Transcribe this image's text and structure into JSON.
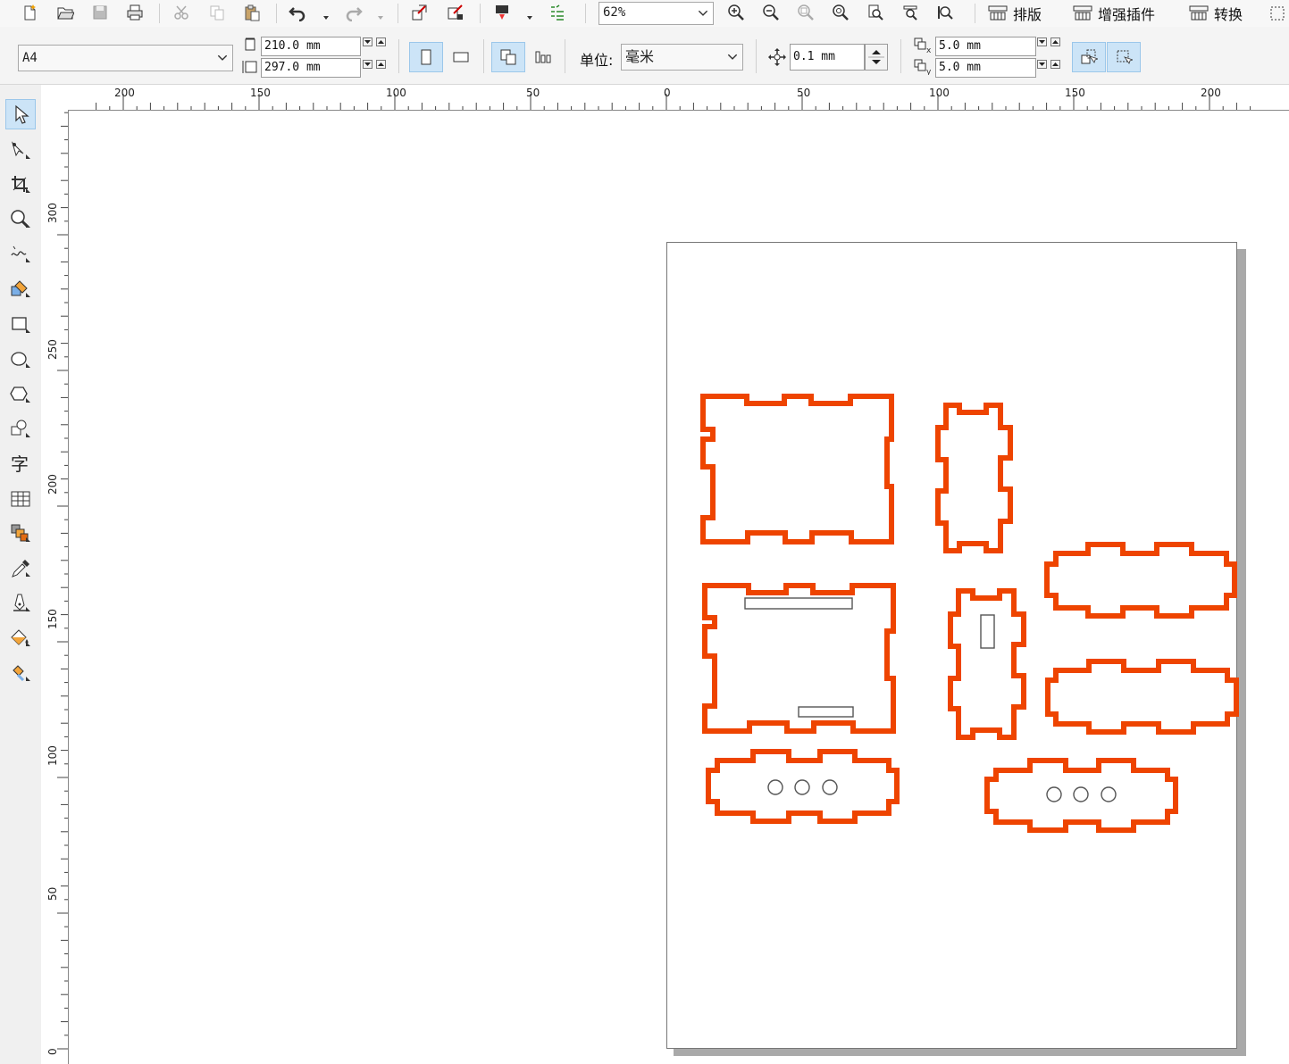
{
  "toolbar": {
    "zoom_value": "62%",
    "plugins": [
      {
        "label": "排版"
      },
      {
        "label": "增强插件"
      },
      {
        "label": "转换"
      }
    ]
  },
  "property_bar": {
    "page_size": "A4",
    "width": "210.0 mm",
    "height": "297.0 mm",
    "unit_label": "单位:",
    "unit_value": "毫米",
    "nudge": "0.1 mm",
    "dup_x": "5.0 mm",
    "dup_y": "5.0 mm"
  },
  "ruler_h": {
    "labels": [
      "200",
      "150",
      "100",
      "50",
      "0",
      "50",
      "100",
      "150",
      "200"
    ]
  },
  "ruler_v": {
    "labels": [
      "300",
      "250",
      "200",
      "150",
      "100",
      "50",
      "0"
    ]
  },
  "colors": {
    "cut_line": "#ee4400",
    "engrave_line": "#555555",
    "page_border": "#777777",
    "selected_button": "#cce4f7"
  },
  "icons": {
    "toolbar": [
      "new-document-icon",
      "open-icon",
      "save-icon",
      "print-icon",
      "cut-icon",
      "copy-icon",
      "paste-icon",
      "undo-icon",
      "redo-icon",
      "import-icon",
      "export-icon",
      "publish-icon",
      "launcher-icon",
      "zoom-in-icon",
      "zoom-out-icon",
      "zoom-selected-icon",
      "zoom-all-icon",
      "zoom-page-icon",
      "zoom-width-icon",
      "zoom-height-icon"
    ],
    "tools": [
      "pick-tool-icon",
      "shape-tool-icon",
      "crop-tool-icon",
      "zoom-tool-icon",
      "freehand-tool-icon",
      "smart-fill-icon",
      "rectangle-tool-icon",
      "ellipse-tool-icon",
      "polygon-tool-icon",
      "basic-shapes-icon",
      "text-tool-icon",
      "table-tool-icon",
      "blend-tool-icon",
      "eyedropper-tool-icon",
      "outline-pen-icon",
      "fill-tool-icon",
      "interactive-fill-icon"
    ]
  }
}
